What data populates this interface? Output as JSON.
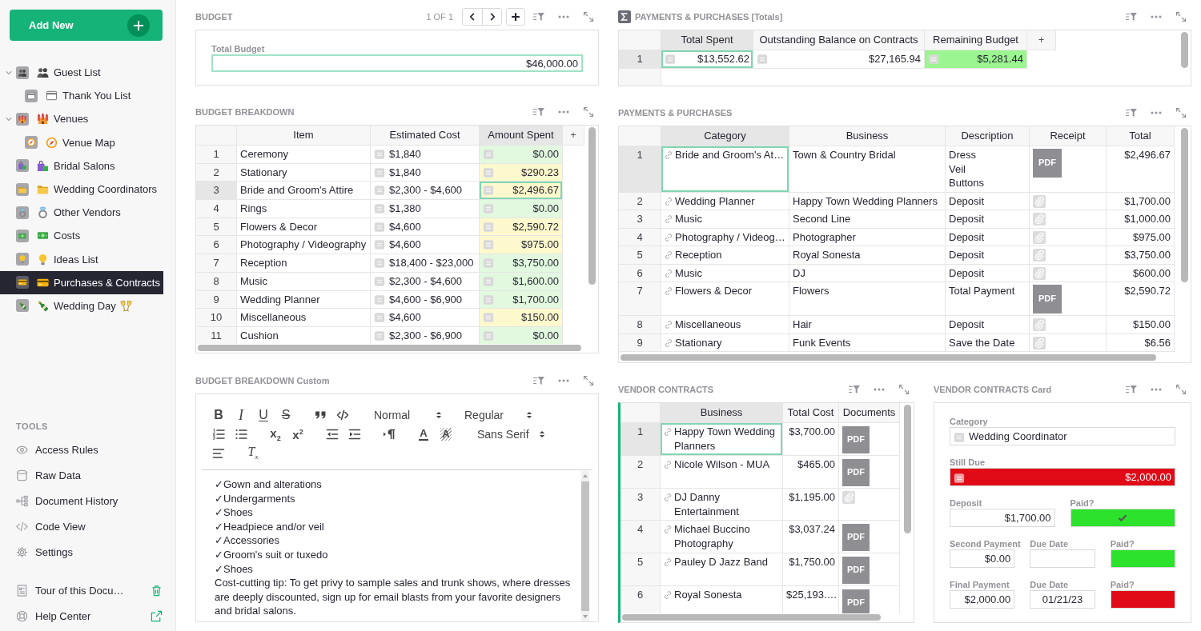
{
  "sidebar": {
    "add_button": "Add New",
    "pages": [
      {
        "label": "Guest List",
        "kind": "people",
        "expanded": true,
        "selected": false,
        "children": [
          {
            "label": "Thank You List",
            "kind": "window",
            "selected": false
          }
        ]
      },
      {
        "label": "Venues",
        "kind": "castle",
        "expanded": true,
        "selected": false,
        "children": [
          {
            "label": "Venue Map",
            "kind": "compass",
            "selected": false
          }
        ]
      },
      {
        "label": "Bridal Salons",
        "kind": "bags",
        "selected": false
      },
      {
        "label": "Wedding Coordinators",
        "kind": "folder",
        "selected": false
      },
      {
        "label": "Other Vendors",
        "kind": "ring",
        "selected": false
      },
      {
        "label": "Costs",
        "kind": "money",
        "selected": false
      },
      {
        "label": "Ideas List",
        "kind": "bulb",
        "selected": false
      },
      {
        "label": "Purchases & Contracts",
        "kind": "card",
        "selected": true
      },
      {
        "label": "Wedding Day",
        "kind": "celebration",
        "selected": false
      }
    ],
    "tools_heading": "TOOLS",
    "tools": [
      {
        "label": "Access Rules",
        "kind": "eye"
      },
      {
        "label": "Raw Data",
        "kind": "database"
      },
      {
        "label": "Document History",
        "kind": "history"
      },
      {
        "label": "Code View",
        "kind": "code"
      },
      {
        "label": "Settings",
        "kind": "gear"
      }
    ],
    "footer": [
      {
        "label": "Tour of this Docu…",
        "kind": "tour"
      },
      {
        "label": "Help Center",
        "kind": "help"
      }
    ]
  },
  "budget": {
    "title": "BUDGET",
    "active": false,
    "pager": "1 OF 1",
    "field": {
      "label": "Total Budget",
      "value": "$46,000.00",
      "focused": true
    }
  },
  "payments_totals": {
    "title": "PAYMENTS & PURCHASES [Totals]",
    "active": false,
    "columns": [
      {
        "label": "Total Spent",
        "kind": "formula_number",
        "selected": true
      },
      {
        "label": "Outstanding Balance on Contracts",
        "kind": "formula_number",
        "selected": false
      },
      {
        "label": "Remaining Budget",
        "kind": "formula_number",
        "selected": false
      }
    ],
    "add_column": "+",
    "rows": [
      {
        "number": "1",
        "selected": true,
        "cells": [
          {
            "value": "$13,552.62"
          },
          {
            "value": "$27,165.94"
          },
          {
            "value": "$5,281.44",
            "color": "#9bf590"
          }
        ]
      }
    ]
  },
  "budget_breakdown": {
    "title": "BUDGET BREAKDOWN",
    "active": false,
    "columns": [
      {
        "label": "Item",
        "kind": "text",
        "selected": false
      },
      {
        "label": "Estimated Cost",
        "kind": "formula",
        "selected": false
      },
      {
        "label": "Amount Spent",
        "kind": "formula_number",
        "selected": true
      }
    ],
    "add_column": "+",
    "rows": [
      {
        "number": "1",
        "selected": false,
        "cells": [
          {
            "value": "Ceremony"
          },
          {
            "value": "$1,840"
          },
          {
            "value": "$0.00",
            "color": "#e2f9df"
          }
        ]
      },
      {
        "number": "2",
        "selected": false,
        "cells": [
          {
            "value": "Stationary"
          },
          {
            "value": "$1,840"
          },
          {
            "value": "$290.23",
            "color": "#fef9cd"
          }
        ]
      },
      {
        "number": "3",
        "selected": true,
        "cells": [
          {
            "value": "Bride and Groom's Attire"
          },
          {
            "value": "$2,300 - $4,600"
          },
          {
            "value": "$2,496.67",
            "color": "#fef9cd"
          }
        ]
      },
      {
        "number": "4",
        "selected": false,
        "cells": [
          {
            "value": "Rings"
          },
          {
            "value": "$1,380"
          },
          {
            "value": "$0.00",
            "color": "#e2f9df"
          }
        ]
      },
      {
        "number": "5",
        "selected": false,
        "cells": [
          {
            "value": "Flowers & Decor"
          },
          {
            "value": "$4,600"
          },
          {
            "value": "$2,590.72",
            "color": "#fef9cd"
          }
        ]
      },
      {
        "number": "6",
        "selected": false,
        "cells": [
          {
            "value": "Photography / Videography"
          },
          {
            "value": "$4,600"
          },
          {
            "value": "$975.00",
            "color": "#fef9cd"
          }
        ]
      },
      {
        "number": "7",
        "selected": false,
        "cells": [
          {
            "value": "Reception"
          },
          {
            "value": "$18,400 - $23,000"
          },
          {
            "value": "$3,750.00",
            "color": "#e2f9df"
          }
        ]
      },
      {
        "number": "8",
        "selected": false,
        "cells": [
          {
            "value": "Music"
          },
          {
            "value": "$2,300 - $4,600"
          },
          {
            "value": "$1,600.00",
            "color": "#e2f9df"
          }
        ]
      },
      {
        "number": "9",
        "selected": false,
        "cells": [
          {
            "value": "Wedding Planner"
          },
          {
            "value": "$4,600 - $6,900"
          },
          {
            "value": "$1,700.00",
            "color": "#e2f9df"
          }
        ]
      },
      {
        "number": "10",
        "selected": false,
        "cells": [
          {
            "value": "Miscellaneous"
          },
          {
            "value": "$4,600"
          },
          {
            "value": "$150.00",
            "color": "#fef9cd"
          }
        ]
      },
      {
        "number": "11",
        "selected": false,
        "cells": [
          {
            "value": "Cushion"
          },
          {
            "value": "$2,300 - $6,900"
          },
          {
            "value": "$0.00",
            "color": "#e2f9df"
          }
        ]
      }
    ]
  },
  "payments_purchases": {
    "title": "PAYMENTS & PURCHASES",
    "active": false,
    "columns": [
      {
        "label": "Category",
        "kind": "link",
        "selected": true
      },
      {
        "label": "Business",
        "kind": "text",
        "selected": false
      },
      {
        "label": "Description",
        "kind": "text",
        "selected": false
      },
      {
        "label": "Receipt",
        "kind": "attachment",
        "selected": false
      },
      {
        "label": "Total",
        "kind": "number",
        "selected": false
      }
    ],
    "rows": [
      {
        "number": "1",
        "selected": true,
        "cells": [
          {
            "value": "Bride and Groom's At…"
          },
          {
            "value": "Town & Country Bridal"
          },
          {
            "value": "Dress\nVeil\nButtons"
          },
          {
            "kind": "pdf",
            "label": "PDF"
          },
          {
            "value": "$2,496.67"
          }
        ]
      },
      {
        "number": "2",
        "selected": false,
        "cells": [
          {
            "value": "Wedding Planner"
          },
          {
            "value": "Happy Town Wedding Planners"
          },
          {
            "value": "Deposit"
          },
          {
            "kind": "placeholder"
          },
          {
            "value": "$1,700.00"
          }
        ]
      },
      {
        "number": "3",
        "selected": false,
        "cells": [
          {
            "value": "Music"
          },
          {
            "value": "Second Line"
          },
          {
            "value": "Deposit"
          },
          {
            "kind": "placeholder"
          },
          {
            "value": "$1,000.00"
          }
        ]
      },
      {
        "number": "4",
        "selected": false,
        "cells": [
          {
            "value": "Photography / Videog…"
          },
          {
            "value": "Photographer"
          },
          {
            "value": "Deposit"
          },
          {
            "kind": "placeholder"
          },
          {
            "value": "$975.00"
          }
        ]
      },
      {
        "number": "5",
        "selected": false,
        "cells": [
          {
            "value": "Reception"
          },
          {
            "value": "Royal Sonesta"
          },
          {
            "value": "Deposit"
          },
          {
            "kind": "placeholder"
          },
          {
            "value": "$3,750.00"
          }
        ]
      },
      {
        "number": "6",
        "selected": false,
        "cells": [
          {
            "value": "Music"
          },
          {
            "value": "DJ"
          },
          {
            "value": "Deposit"
          },
          {
            "kind": "placeholder"
          },
          {
            "value": "$600.00"
          }
        ]
      },
      {
        "number": "7",
        "selected": false,
        "cells": [
          {
            "value": "Flowers & Decor"
          },
          {
            "value": "Flowers"
          },
          {
            "value": "Total Payment"
          },
          {
            "kind": "pdf",
            "label": "PDF"
          },
          {
            "value": "$2,590.72"
          }
        ]
      },
      {
        "number": "8",
        "selected": false,
        "cells": [
          {
            "value": "Miscellaneous"
          },
          {
            "value": "Hair"
          },
          {
            "value": "Deposit"
          },
          {
            "kind": "placeholder"
          },
          {
            "value": "$150.00"
          }
        ]
      },
      {
        "number": "9",
        "selected": false,
        "cells": [
          {
            "value": "Stationary"
          },
          {
            "value": "Funk Events"
          },
          {
            "value": "Save the Date"
          },
          {
            "kind": "placeholder"
          },
          {
            "value": "$6.56"
          }
        ]
      }
    ]
  },
  "budget_breakdown_custom": {
    "title": "BUDGET BREAKDOWN Custom",
    "active": false,
    "toolbar": [
      [
        [
          {
            "kind": "bold",
            "label": "B"
          },
          {
            "kind": "italic",
            "label": "I"
          },
          {
            "kind": "underline",
            "label": "U"
          },
          {
            "kind": "strike",
            "label": "S"
          }
        ],
        [
          {
            "kind": "quote"
          },
          {
            "kind": "code"
          }
        ],
        [
          {
            "kind": "select",
            "label": "Normal"
          }
        ],
        [
          {
            "kind": "select",
            "label": "Regular"
          }
        ]
      ],
      [
        [
          {
            "kind": "ordered"
          },
          {
            "kind": "bullet"
          }
        ],
        [
          {
            "kind": "subscript",
            "label": "x$_{2}$"
          },
          {
            "kind": "superscript",
            "label": "x$^{2}$"
          }
        ],
        [
          {
            "kind": "outdent"
          },
          {
            "kind": "indent"
          }
        ],
        [
          {
            "kind": "direction"
          }
        ],
        [
          {
            "kind": "color",
            "label": "A"
          },
          {
            "kind": "background",
            "label": "A"
          }
        ],
        [
          {
            "kind": "select",
            "label": "Sans Serif"
          }
        ]
      ],
      [
        [
          {
            "kind": "align"
          }
        ],
        [
          {
            "kind": "clean",
            "label": "T$_{x}$"
          }
        ]
      ]
    ],
    "paragraphs": [
      "✓Gown and alterations",
      "✓Undergarments",
      "✓Shoes",
      "✓Headpiece and/or veil",
      "✓Accessories",
      "✓Groom's suit or tuxedo",
      "✓Shoes",
      "Cost-cutting tip: To get privy to sample sales and trunk shows, where dresses are deeply discounted, sign up for email blasts from your favorite designers and bridal salons."
    ]
  },
  "vendor_contracts": {
    "title": "VENDOR CONTRACTS",
    "active": true,
    "columns": [
      {
        "label": "Business",
        "kind": "link",
        "selected": true
      },
      {
        "label": "Total Cost",
        "kind": "number",
        "selected": false
      },
      {
        "label": "Documents",
        "kind": "attachment",
        "selected": false
      }
    ],
    "rows": [
      {
        "number": "1",
        "selected": true,
        "cells": [
          {
            "value": "Happy Town Wedding Planners"
          },
          {
            "value": "$3,700.00"
          },
          {
            "kind": "pdf",
            "label": "PDF"
          }
        ]
      },
      {
        "number": "2",
        "selected": false,
        "cells": [
          {
            "value": "Nicole Wilson - MUA"
          },
          {
            "value": "$465.00"
          },
          {
            "kind": "pdf",
            "label": "PDF"
          }
        ]
      },
      {
        "number": "3",
        "selected": false,
        "cells": [
          {
            "value": "DJ Danny Entertainment"
          },
          {
            "value": "$1,195.00"
          },
          {
            "kind": "placeholder"
          }
        ]
      },
      {
        "number": "4",
        "selected": false,
        "cells": [
          {
            "value": "Michael Buccino Photography"
          },
          {
            "value": "$3,037.24"
          },
          {
            "kind": "pdf",
            "label": "PDF"
          }
        ]
      },
      {
        "number": "5",
        "selected": false,
        "cells": [
          {
            "value": "Pauley D Jazz Band"
          },
          {
            "value": "$1,750.00"
          },
          {
            "kind": "pdf",
            "label": "PDF"
          }
        ]
      },
      {
        "number": "6",
        "selected": false,
        "cells": [
          {
            "value": "Royal Sonesta"
          },
          {
            "value": "$25,193.…"
          },
          {
            "kind": "pdf",
            "label": "PDF"
          }
        ]
      }
    ]
  },
  "vendor_contracts_card": {
    "title": "VENDOR CONTRACTS Card",
    "active": false,
    "rows": [
      {
        "fields": [
          {
            "label": "Category",
            "kind": "reference",
            "value": "Wedding Coordinator"
          }
        ]
      },
      {
        "fields": [
          {
            "label": "Still Due",
            "kind": "formula",
            "value": "$2,000.00",
            "color": "#e00b17"
          }
        ]
      },
      {
        "fields": [
          {
            "label": "Deposit",
            "kind": "number",
            "value": "$1,700.00"
          },
          {
            "label": "Paid?",
            "kind": "toggle",
            "checked": true,
            "color": "#2ce22c"
          }
        ]
      },
      {
        "fields": [
          {
            "label": "Second Payment",
            "kind": "number",
            "value": "$0.00"
          },
          {
            "label": "Due Date",
            "kind": "date"
          },
          {
            "label": "Paid?",
            "kind": "toggle",
            "checked": false,
            "color": "#2ce22c"
          }
        ]
      },
      {
        "fields": [
          {
            "label": "Final Payment",
            "kind": "number",
            "value": "$2,000.00"
          },
          {
            "label": "Due Date",
            "kind": "date",
            "value": "01/21/23"
          },
          {
            "label": "Paid?",
            "kind": "toggle",
            "checked": false,
            "color": "#e00b17"
          }
        ]
      }
    ]
  }
}
